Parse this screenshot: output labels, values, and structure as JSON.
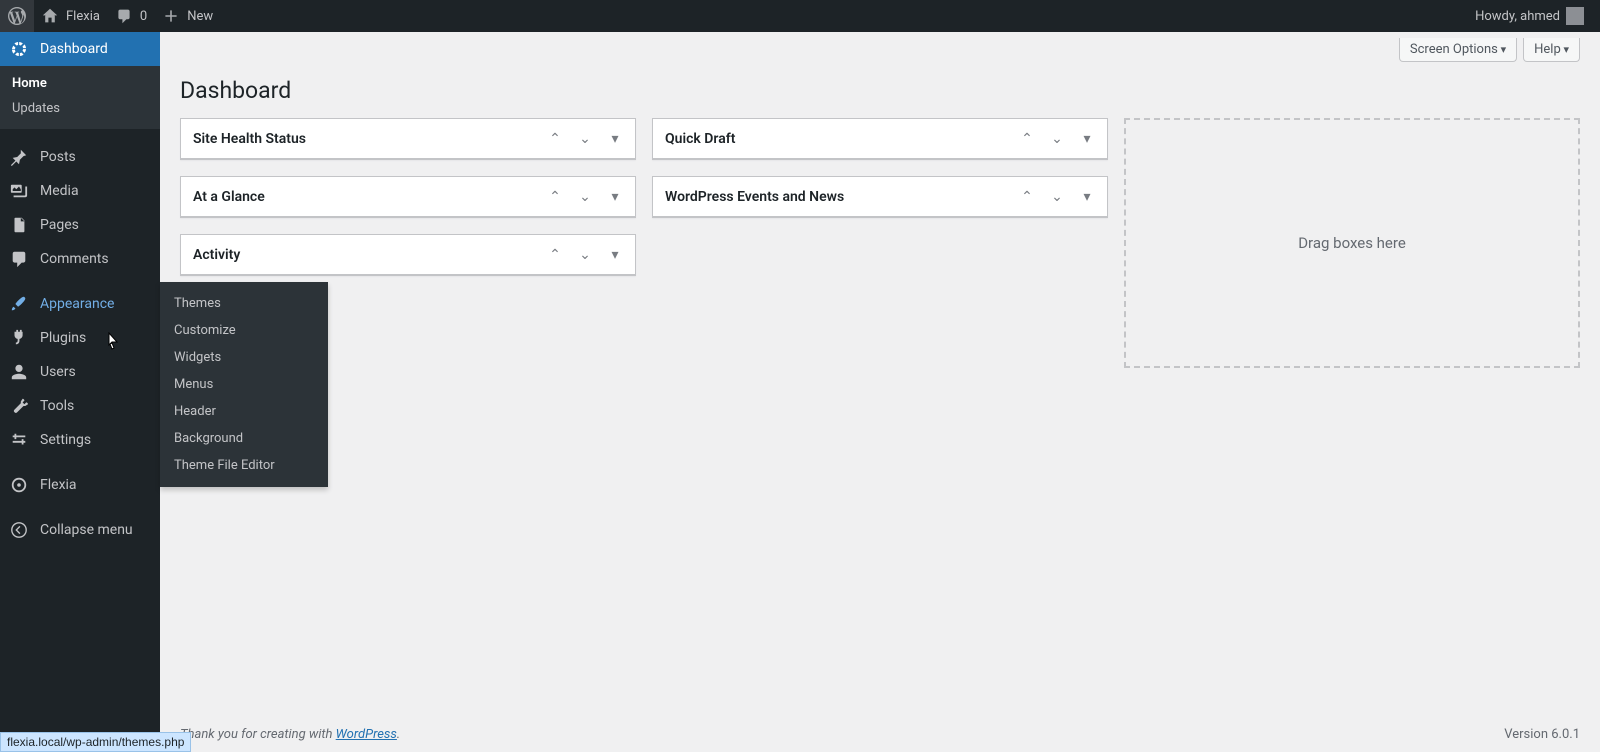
{
  "adminbar": {
    "site_name": "Flexia",
    "comments_count": "0",
    "new_label": "New",
    "greeting": "Howdy, ahmed"
  },
  "sidebar": {
    "dashboard": "Dashboard",
    "dashboard_sub": {
      "home": "Home",
      "updates": "Updates"
    },
    "posts": "Posts",
    "media": "Media",
    "pages": "Pages",
    "comments": "Comments",
    "appearance": "Appearance",
    "plugins": "Plugins",
    "users": "Users",
    "tools": "Tools",
    "settings": "Settings",
    "flexia": "Flexia",
    "collapse": "Collapse menu"
  },
  "appearance_submenu": [
    "Themes",
    "Customize",
    "Widgets",
    "Menus",
    "Header",
    "Background",
    "Theme File Editor"
  ],
  "header_tabs": {
    "screen_options": "Screen Options",
    "help": "Help"
  },
  "page_title": "Dashboard",
  "widgets": {
    "col1": [
      "Site Health Status",
      "At a Glance",
      "Activity"
    ],
    "col2": [
      "Quick Draft",
      "WordPress Events and News"
    ]
  },
  "dropzone_text": "Drag boxes here",
  "footer": {
    "thank_prefix": "Thank you for creating with ",
    "link_text": "WordPress",
    "version": "Version 6.0.1"
  },
  "status_url": "flexia.local/wp-admin/themes.php"
}
